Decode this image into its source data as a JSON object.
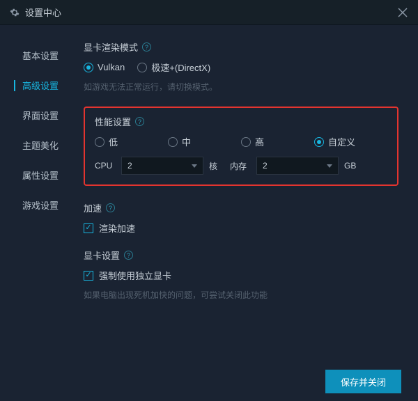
{
  "titlebar": {
    "title": "设置中心"
  },
  "sidebar": {
    "items": [
      {
        "label": "基本设置"
      },
      {
        "label": "高级设置"
      },
      {
        "label": "界面设置"
      },
      {
        "label": "主题美化"
      },
      {
        "label": "属性设置"
      },
      {
        "label": "游戏设置"
      }
    ],
    "activeIndex": 1
  },
  "render": {
    "title": "显卡渲染模式",
    "options": [
      {
        "label": "Vulkan",
        "selected": true
      },
      {
        "label": "极速+(DirectX)",
        "selected": false
      }
    ],
    "hint": "如游戏无法正常运行，请切换模式。"
  },
  "perf": {
    "title": "性能设置",
    "options": [
      {
        "label": "低",
        "selected": false
      },
      {
        "label": "中",
        "selected": false
      },
      {
        "label": "高",
        "selected": false
      },
      {
        "label": "自定义",
        "selected": true
      }
    ],
    "cpu": {
      "label": "CPU",
      "value": "2",
      "unit": "核"
    },
    "mem": {
      "label": "内存",
      "value": "2",
      "unit": "GB"
    }
  },
  "accel": {
    "title": "加速",
    "checkbox": {
      "label": "渲染加速",
      "checked": true
    }
  },
  "gpu": {
    "title": "显卡设置",
    "checkbox": {
      "label": "强制使用独立显卡",
      "checked": true
    },
    "hint": "如果电脑出现死机加快的问题，可尝试关闭此功能"
  },
  "footer": {
    "save": "保存并关闭"
  }
}
